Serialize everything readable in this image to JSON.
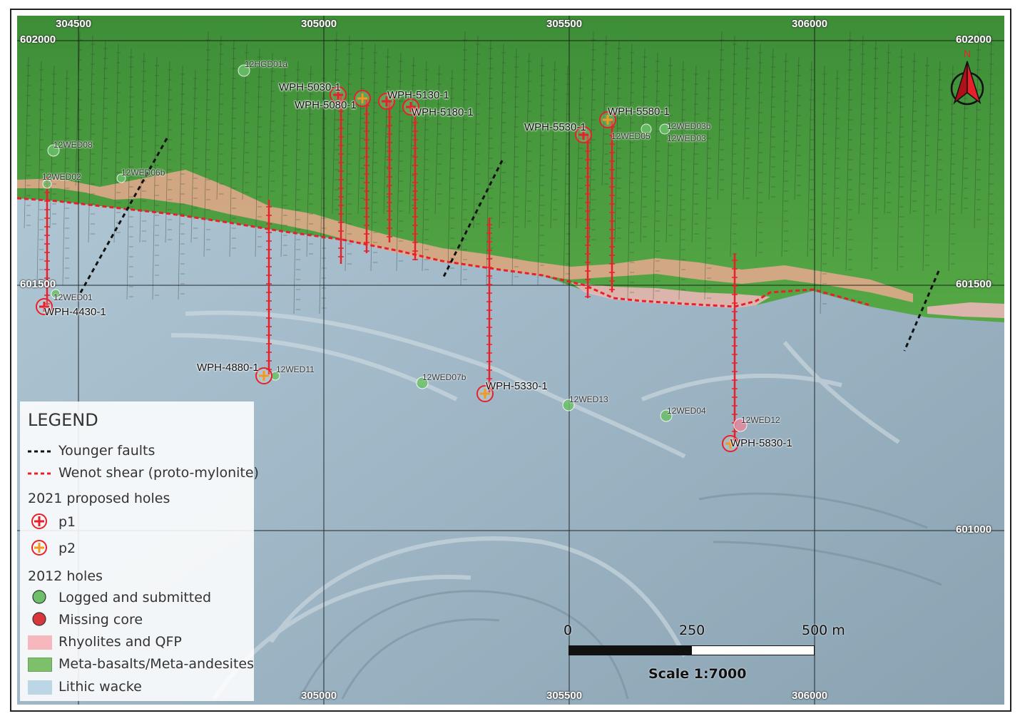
{
  "map": {
    "grid": {
      "top_labels": [
        "304500",
        "305000",
        "305500",
        "306000"
      ],
      "bottom_labels": [
        "305000",
        "305500",
        "306000"
      ],
      "left_labels": [
        "602000",
        "601500"
      ],
      "right_labels": [
        "602000",
        "601500",
        "601000"
      ]
    },
    "proposed_holes": [
      {
        "id": "WPH-4430-1",
        "class": "p1"
      },
      {
        "id": "WPH-4880-1",
        "class": "p2"
      },
      {
        "id": "WPH-5030-1",
        "class": "p1"
      },
      {
        "id": "WPH-5080-1",
        "class": "p2"
      },
      {
        "id": "WPH-5130-1",
        "class": "p1"
      },
      {
        "id": "WPH-5180-1",
        "class": "p1"
      },
      {
        "id": "WPH-5330-1",
        "class": "p2"
      },
      {
        "id": "WPH-5530-1",
        "class": "p1"
      },
      {
        "id": "WPH-5580-1",
        "class": "p2"
      },
      {
        "id": "WPH-5830-1",
        "class": "p2"
      }
    ],
    "holes_2012": [
      {
        "id": "12HGD01a",
        "status": "logged"
      },
      {
        "id": "12WED08",
        "status": "logged"
      },
      {
        "id": "12WED02",
        "status": "logged"
      },
      {
        "id": "12WED06b",
        "status": "logged"
      },
      {
        "id": "12WED05",
        "status": "logged"
      },
      {
        "id": "12WED03b",
        "status": "logged"
      },
      {
        "id": "12WED03",
        "status": "logged"
      },
      {
        "id": "12WED01",
        "status": "logged"
      },
      {
        "id": "12WED11",
        "status": "logged"
      },
      {
        "id": "12WED07b",
        "status": "logged"
      },
      {
        "id": "12WED13",
        "status": "logged"
      },
      {
        "id": "12WED04",
        "status": "logged"
      },
      {
        "id": "12WED12",
        "status": "missing"
      }
    ],
    "north_label": "N"
  },
  "legend": {
    "title": "LEGEND",
    "younger_faults": "Younger faults",
    "wenot_shear": "Wenot shear (proto-mylonite)",
    "proposed_heading": "2021 proposed holes",
    "p1": "p1",
    "p2": "p2",
    "holes_2012_heading": "2012 holes",
    "logged": "Logged and submitted",
    "missing": "Missing core",
    "rhyolites": "Rhyolites and QFP",
    "meta_basalts": "Meta-basalts/Meta-andesites",
    "lithic_wacke": "Lithic wacke",
    "colors": {
      "fault": "#111111",
      "shear": "#e8202a",
      "p1": "#e8202a",
      "p2": "#f29a1e",
      "logged": "#6cc06a",
      "missing": "#d9363e",
      "rhyolites": "#f6b8bd",
      "meta_basalts": "#7dbf6b",
      "lithic_wacke": "#bcd6e6"
    }
  },
  "scale": {
    "ticks": [
      "0",
      "250",
      "500 m"
    ],
    "text": "Scale 1:7000"
  }
}
